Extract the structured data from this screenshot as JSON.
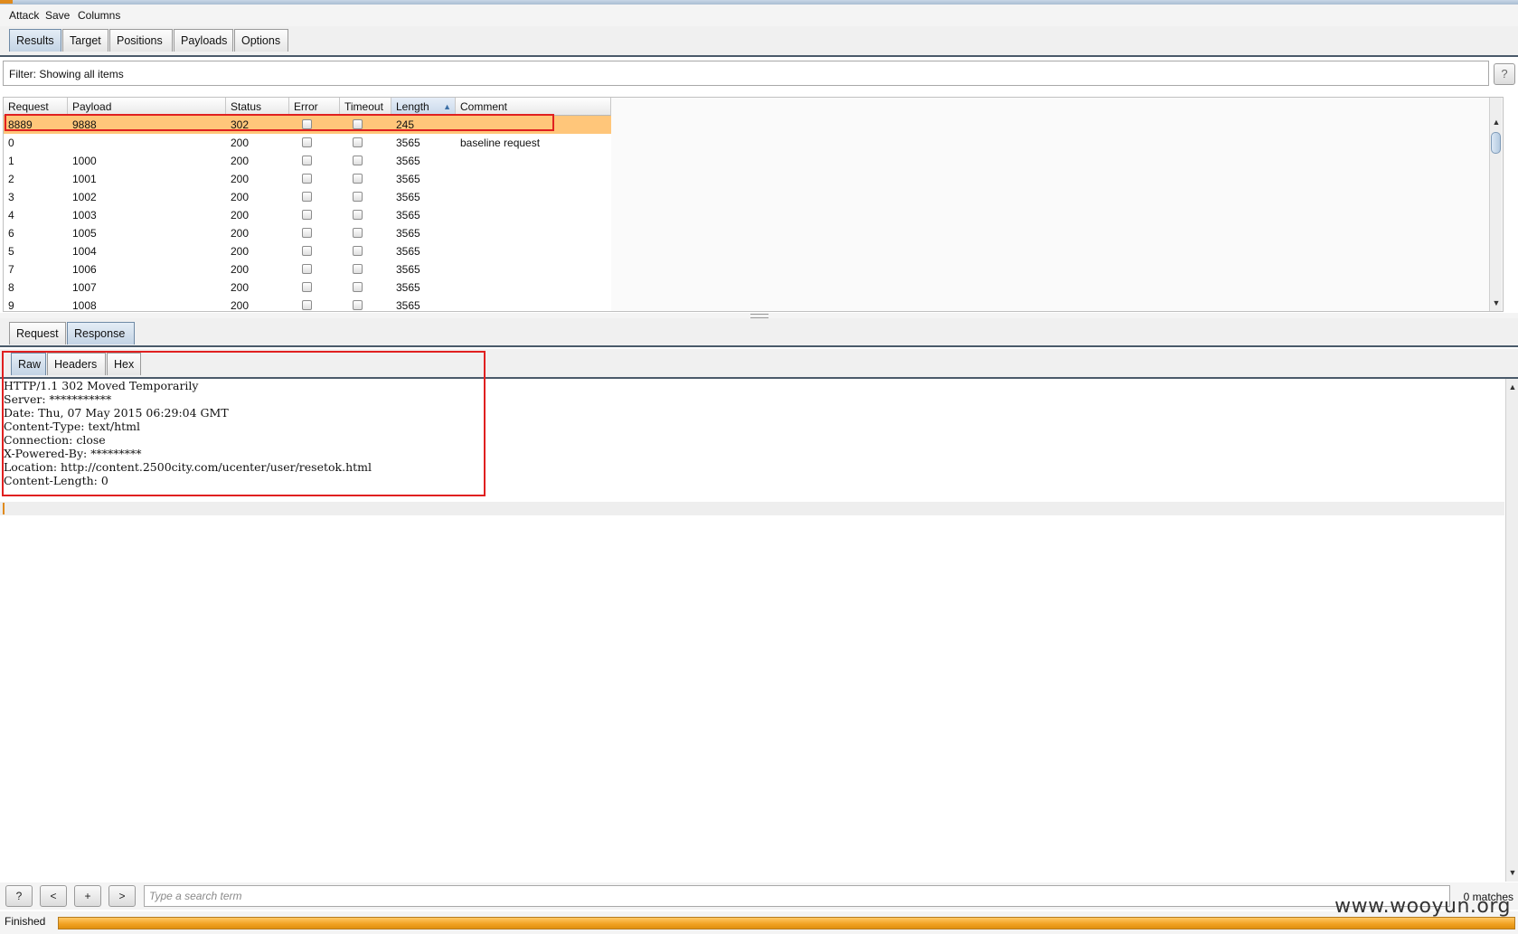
{
  "menu": [
    "Attack",
    "Save",
    "Columns"
  ],
  "main_tabs": [
    "Results",
    "Target",
    "Positions",
    "Payloads",
    "Options"
  ],
  "active_main_tab": "Results",
  "filter": {
    "label": "Filter: Showing all items",
    "help": "?"
  },
  "results_table": {
    "columns": [
      "Request",
      "Payload",
      "Status",
      "Error",
      "Timeout",
      "Length",
      "Comment"
    ],
    "sorted_column": "Length",
    "sort_direction": "ascending",
    "rows": [
      {
        "request": "8889",
        "payload": "9888",
        "status": "302",
        "error": false,
        "timeout": false,
        "length": "245",
        "comment": "",
        "selected": true
      },
      {
        "request": "0",
        "payload": "",
        "status": "200",
        "error": false,
        "timeout": false,
        "length": "3565",
        "comment": "baseline request",
        "selected": false
      },
      {
        "request": "1",
        "payload": "1000",
        "status": "200",
        "error": false,
        "timeout": false,
        "length": "3565",
        "comment": "",
        "selected": false
      },
      {
        "request": "2",
        "payload": "1001",
        "status": "200",
        "error": false,
        "timeout": false,
        "length": "3565",
        "comment": "",
        "selected": false
      },
      {
        "request": "3",
        "payload": "1002",
        "status": "200",
        "error": false,
        "timeout": false,
        "length": "3565",
        "comment": "",
        "selected": false
      },
      {
        "request": "4",
        "payload": "1003",
        "status": "200",
        "error": false,
        "timeout": false,
        "length": "3565",
        "comment": "",
        "selected": false
      },
      {
        "request": "6",
        "payload": "1005",
        "status": "200",
        "error": false,
        "timeout": false,
        "length": "3565",
        "comment": "",
        "selected": false
      },
      {
        "request": "5",
        "payload": "1004",
        "status": "200",
        "error": false,
        "timeout": false,
        "length": "3565",
        "comment": "",
        "selected": false
      },
      {
        "request": "7",
        "payload": "1006",
        "status": "200",
        "error": false,
        "timeout": false,
        "length": "3565",
        "comment": "",
        "selected": false
      },
      {
        "request": "8",
        "payload": "1007",
        "status": "200",
        "error": false,
        "timeout": false,
        "length": "3565",
        "comment": "",
        "selected": false
      },
      {
        "request": "9",
        "payload": "1008",
        "status": "200",
        "error": false,
        "timeout": false,
        "length": "3565",
        "comment": "",
        "selected": false
      }
    ]
  },
  "detail_tabs": [
    "Request",
    "Response"
  ],
  "active_detail_tab": "Response",
  "view_tabs": [
    "Raw",
    "Headers",
    "Hex"
  ],
  "active_view_tab": "Raw",
  "response_lines": [
    "HTTP/1.1 302 Moved Temporarily",
    "Server: ***********",
    "Date: Thu, 07 May 2015 06:29:04 GMT",
    "Content-Type: text/html",
    "Connection: close",
    "X-Powered-By: *********",
    "Location: http://content.2500city.com/ucenter/user/resetok.html",
    "Content-Length: 0"
  ],
  "search": {
    "buttons": [
      "?",
      "<",
      "+",
      ">"
    ],
    "placeholder": "Type a search term",
    "value": "",
    "matches": "0 matches"
  },
  "status": {
    "text": "Finished",
    "progress_percent": 100
  },
  "watermark": "www.wooyun.org",
  "colors": {
    "selected_row": "#ffc67a",
    "highlight_box": "#e02020",
    "progress": "#f0a020",
    "tab_border": "#4a5a6a"
  }
}
